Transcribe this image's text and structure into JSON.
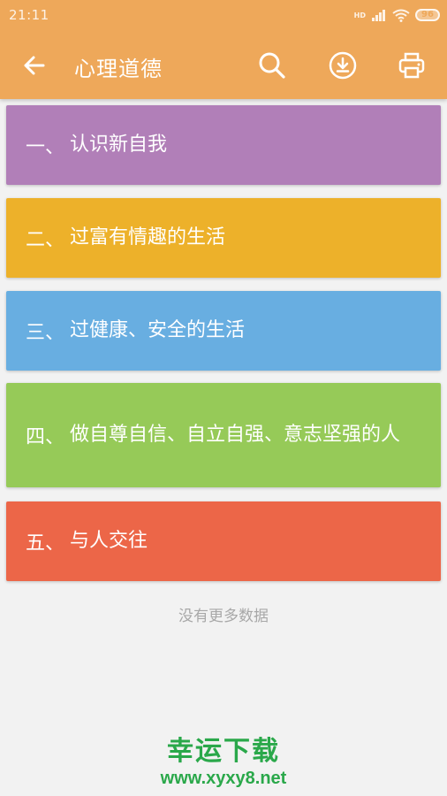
{
  "status_bar": {
    "time": "21:11",
    "network": "HD",
    "battery": "96"
  },
  "toolbar": {
    "title": "心理道德",
    "icons": [
      "back-arrow-icon",
      "search-icon",
      "download-icon",
      "print-icon"
    ]
  },
  "items": [
    {
      "number": "一、",
      "text": "认识新自我",
      "color": "#b17fb8"
    },
    {
      "number": "二、",
      "text": "过富有情趣的生活",
      "color": "#edb12a"
    },
    {
      "number": "三、",
      "text": "过健康、安全的生活",
      "color": "#68aee1"
    },
    {
      "number": "四、",
      "text": "做自尊自信、自立自强、意志坚强的人",
      "color": "#96ca58"
    },
    {
      "number": "五、",
      "text": "与人交往",
      "color": "#ec6648"
    }
  ],
  "footer": {
    "no_more": "没有更多数据"
  },
  "watermark": {
    "title": "幸运下载",
    "url": "www.xyxy8.net"
  },
  "colors": {
    "appbar": "#eea85a",
    "background": "#f2f2f2",
    "watermark": "#2aa84a"
  }
}
